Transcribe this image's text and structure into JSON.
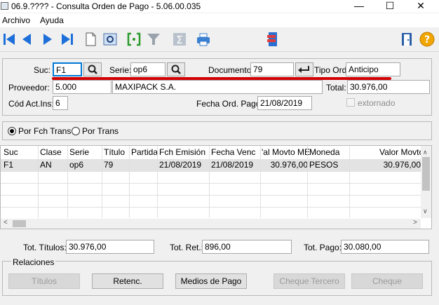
{
  "window": {
    "title": "06.9.???? - Consulta Orden de Pago - 5.06.00.035",
    "minimize": "—",
    "maximize": "☐",
    "close": "✕"
  },
  "menu": {
    "items": [
      "Archivo",
      "Ayuda"
    ]
  },
  "toolbar": {
    "icons": [
      "first-icon",
      "prev-icon",
      "next-icon",
      "last-icon",
      "new-doc-icon",
      "preview-icon",
      "select-icon",
      "filter-icon",
      "sum-icon",
      "print-icon",
      "stack-icon",
      "exit-door-icon",
      "help-icon"
    ]
  },
  "header": {
    "suc_label": "Suc:",
    "suc_value": "F1",
    "serie_label": "Serie:",
    "serie_value": "op6",
    "documento_label": "Documento:",
    "documento_value": "79",
    "tipo_label": "Tipo Ord:",
    "tipo_value": "Anticipo",
    "proveedor_label": "Proveedor:",
    "proveedor_code": "5.000",
    "proveedor_name": "MAXIPACK S.A.",
    "total_label": "Total:",
    "total_value": "30.976,00",
    "cod_label": "Cód Act.Ins:",
    "cod_value": "6",
    "fecha_label": "Fecha Ord. Pago:",
    "fecha_value": "21/08/2019",
    "extornado_label": "extornado"
  },
  "order": {
    "opt1": "Por Fch Trans",
    "opt2": "Por Trans",
    "selected": "Por Fch Trans"
  },
  "grid": {
    "columns": [
      "Suc",
      "Clase",
      "Serie",
      "Título",
      "Partida",
      "Fch Emisión",
      "Fecha Venc",
      "'al Movto ME",
      "Moneda",
      "Valor Movto"
    ],
    "rows": [
      [
        "F1",
        "AN",
        "op6",
        "79",
        "",
        "21/08/2019",
        "21/08/2019",
        "30.976,00",
        "PESOS",
        "30.976,00"
      ]
    ]
  },
  "totals": {
    "titulos_label": "Tot. Títulos:",
    "titulos_value": "30.976,00",
    "ret_label": "Tot. Ret.:",
    "ret_value": "896,00",
    "pago_label": "Tot. Pago:",
    "pago_value": "30.080,00"
  },
  "relaciones": {
    "label": "Relaciones",
    "buttons": [
      "Títulos",
      "Retenc.",
      "Medios de Pago",
      "Cheque Tercero",
      "Cheque"
    ]
  },
  "colors": {
    "underline": "#d40000",
    "toolbar_blue": "#1e6fd9",
    "selection_border": "#0078d7"
  }
}
